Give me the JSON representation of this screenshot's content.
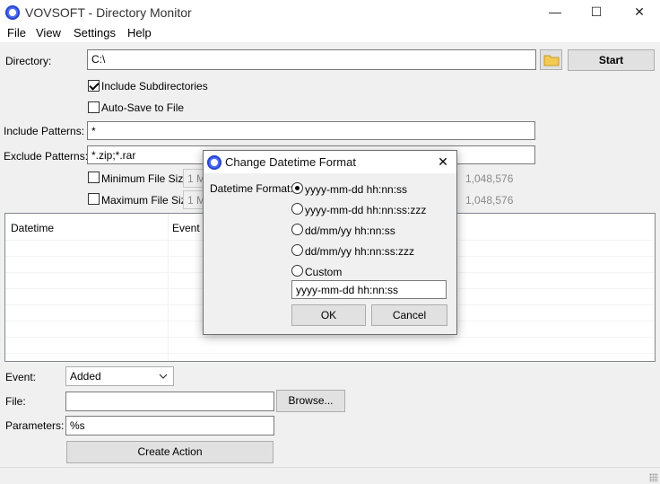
{
  "window": {
    "title": "VOVSOFT - Directory Monitor",
    "minimize": "—",
    "maximize": "☐",
    "close": "✕"
  },
  "menu": [
    "File",
    "View",
    "Settings",
    "Help"
  ],
  "main": {
    "directory_label": "Directory:",
    "directory_value": "C:\\",
    "start_label": "Start",
    "include_subdirs_label": "Include Subdirectories",
    "include_subdirs_checked": true,
    "autosave_label": "Auto-Save to File",
    "autosave_checked": false,
    "include_patterns_label": "Include Patterns:",
    "include_patterns_value": "*",
    "exclude_patterns_label": "Exclude Patterns:",
    "exclude_patterns_value": "*.zip;*.rar",
    "min_size_label": "Minimum File Size:",
    "min_size_value": "1 M",
    "min_size_bytes": "1,048,576",
    "max_size_label": "Maximum File Size:",
    "max_size_value": "1 M",
    "max_size_bytes": "1,048,576"
  },
  "list": {
    "columns": [
      "Datetime",
      "Event"
    ]
  },
  "action": {
    "event_label": "Event:",
    "event_value": "Added",
    "file_label": "File:",
    "file_value": "",
    "browse_label": "Browse...",
    "parameters_label": "Parameters:",
    "parameters_value": "%s",
    "create_label": "Create Action"
  },
  "dialog": {
    "title": "Change Datetime Format",
    "close": "✕",
    "format_label": "Datetime Format:",
    "options": [
      "yyyy-mm-dd hh:nn:ss",
      "yyyy-mm-dd hh:nn:ss:zzz",
      "dd/mm/yy hh:nn:ss",
      "dd/mm/yy hh:nn:ss:zzz",
      "Custom"
    ],
    "selected_index": 0,
    "custom_value": "yyyy-mm-dd hh:nn:ss",
    "ok_label": "OK",
    "cancel_label": "Cancel"
  },
  "colors": {
    "accent": "#4a6cf7",
    "folder": "#f3c853"
  }
}
